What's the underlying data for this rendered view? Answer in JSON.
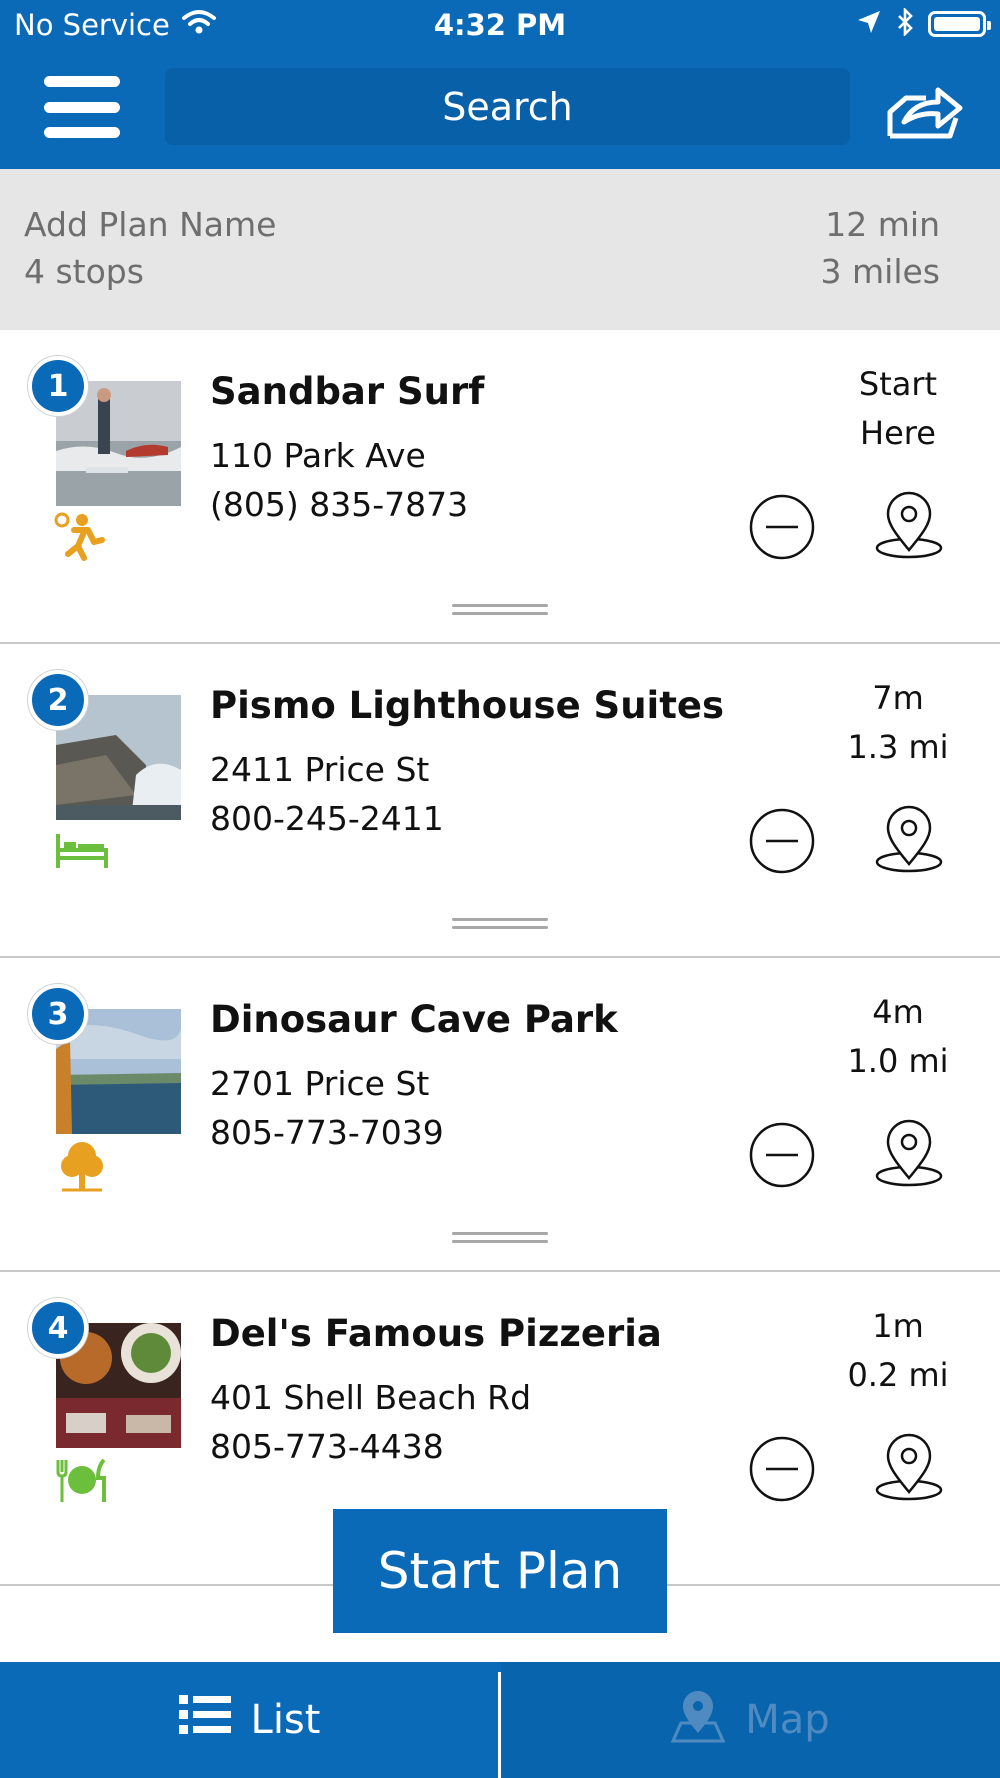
{
  "status_bar": {
    "carrier": "No Service",
    "time": "4:32 PM"
  },
  "nav": {
    "search_placeholder": "Search"
  },
  "plan": {
    "name_placeholder": "Add Plan Name",
    "stops": "4 stops",
    "duration": "12 min",
    "distance": "3 miles"
  },
  "stops": [
    {
      "number": "1",
      "name": "Sandbar Surf",
      "address": "110 Park Ave",
      "phone": "(805) 835-7873",
      "dist_line1": "Start",
      "dist_line2": "Here",
      "category_icon": "activity-icon",
      "category_color": "#e8a020"
    },
    {
      "number": "2",
      "name": "Pismo Lighthouse Suites",
      "address": "2411 Price St",
      "phone": "800-245-2411",
      "dist_line1": "7m",
      "dist_line2": "1.3 mi",
      "category_icon": "lodging-icon",
      "category_color": "#6cbf3c"
    },
    {
      "number": "3",
      "name": "Dinosaur Cave Park",
      "address": "2701 Price St",
      "phone": "805-773-7039",
      "dist_line1": "4m",
      "dist_line2": "1.0 mi",
      "category_icon": "park-tree-icon",
      "category_color": "#e8a020"
    },
    {
      "number": "4",
      "name": "Del's Famous Pizzeria",
      "address": "401 Shell Beach Rd",
      "phone": "805-773-4438",
      "dist_line1": "1m",
      "dist_line2": "0.2 mi",
      "category_icon": "dining-icon",
      "category_color": "#6cbf3c"
    }
  ],
  "actions": {
    "start_plan": "Start Plan"
  },
  "tabs": {
    "list": "List",
    "map": "Map"
  },
  "colors": {
    "primary": "#0a6ab8",
    "summary_bg": "#e6e6e6"
  }
}
